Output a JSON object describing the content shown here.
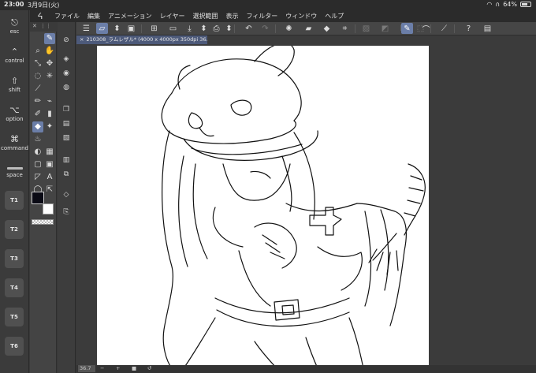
{
  "status_bar": {
    "time": "23:00",
    "date": "3月9日(火)",
    "battery": "64%"
  },
  "menu": {
    "items": [
      "ファイル",
      "編集",
      "アニメーション",
      "レイヤー",
      "選択範囲",
      "表示",
      "フィルター",
      "ウィンドウ",
      "ヘルプ"
    ]
  },
  "modifiers": [
    {
      "glyph": "⎋",
      "label": "esc"
    },
    {
      "glyph": "⌃",
      "label": "control"
    },
    {
      "glyph": "⇧",
      "label": "shift"
    },
    {
      "glyph": "⌥",
      "label": "option"
    },
    {
      "glyph": "⌘",
      "label": "command"
    },
    {
      "glyph": "",
      "label": "space"
    }
  ],
  "tkeys": [
    "T1",
    "T2",
    "T3",
    "T4",
    "T5",
    "T6"
  ],
  "toolbar": {
    "icons": [
      "menu-icon",
      "layer-icon",
      "up-down-icon",
      "image-icon",
      "new-layer-icon",
      "folder-icon",
      "save-icon",
      "up-down-icon",
      "print-icon",
      "up-down-icon",
      "undo-icon",
      "redo-icon",
      "brightness-icon",
      "fill-icon",
      "eraser-icon",
      "transform-icon",
      "cut-icon",
      "pattern-icon",
      "wrap-icon",
      "lasso-icon",
      "pen-active-icon",
      "brush-icon",
      "line-icon",
      "help-icon",
      "settings-icon"
    ]
  },
  "document": {
    "tab_label": "210308_ラムレザル* (4000 x 4000px 350dpi 36.7%)"
  },
  "bottom": {
    "zoom": "36.7"
  },
  "colors": {
    "main": "#0a0a14",
    "sub": "#ffffff",
    "accent": "#6b7ea8"
  }
}
